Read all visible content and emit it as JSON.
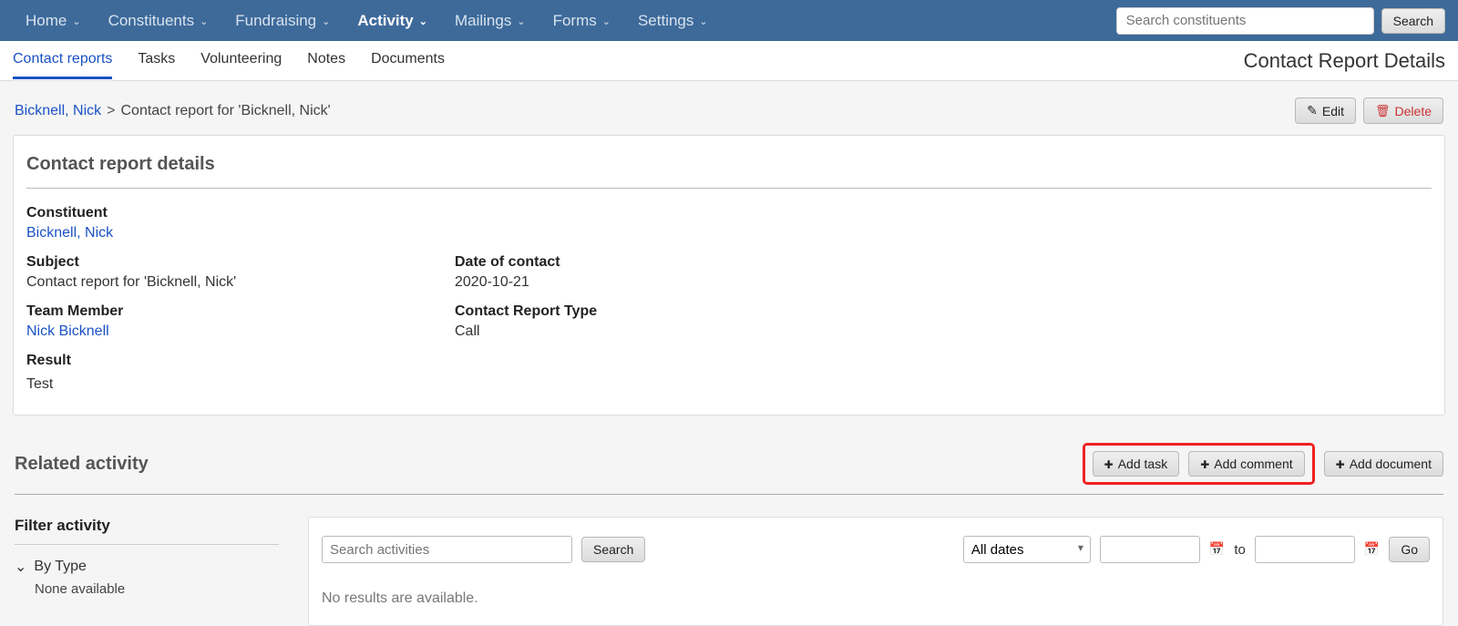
{
  "nav": {
    "items": [
      {
        "label": "Home"
      },
      {
        "label": "Constituents"
      },
      {
        "label": "Fundraising"
      },
      {
        "label": "Activity"
      },
      {
        "label": "Mailings"
      },
      {
        "label": "Forms"
      },
      {
        "label": "Settings"
      }
    ],
    "active_index": 3,
    "search_placeholder": "Search constituents",
    "search_button": "Search"
  },
  "subtabs": {
    "items": [
      "Contact reports",
      "Tasks",
      "Volunteering",
      "Notes",
      "Documents"
    ],
    "active_index": 0,
    "page_title": "Contact Report Details"
  },
  "breadcrumb": {
    "link": "Bicknell, Nick",
    "sep": ">",
    "current": "Contact report for 'Bicknell, Nick'"
  },
  "actions": {
    "edit": "Edit",
    "delete": "Delete"
  },
  "details": {
    "section_title": "Contact report details",
    "constituent_label": "Constituent",
    "constituent_value": "Bicknell, Nick",
    "subject_label": "Subject",
    "subject_value": "Contact report for 'Bicknell, Nick'",
    "date_label": "Date of contact",
    "date_value": "2020-10-21",
    "team_label": "Team Member",
    "team_value": "Nick Bicknell",
    "type_label": "Contact Report Type",
    "type_value": "Call",
    "result_label": "Result",
    "result_value": "Test"
  },
  "related": {
    "title": "Related activity",
    "add_task": "Add task",
    "add_comment": "Add comment",
    "add_document": "Add document"
  },
  "filter": {
    "title": "Filter activity",
    "by_type": "By Type",
    "none": "None available"
  },
  "activity": {
    "search_placeholder": "Search activities",
    "search_button": "Search",
    "dates_option": "All dates",
    "to_label": "to",
    "go_button": "Go",
    "no_results": "No results are available."
  }
}
